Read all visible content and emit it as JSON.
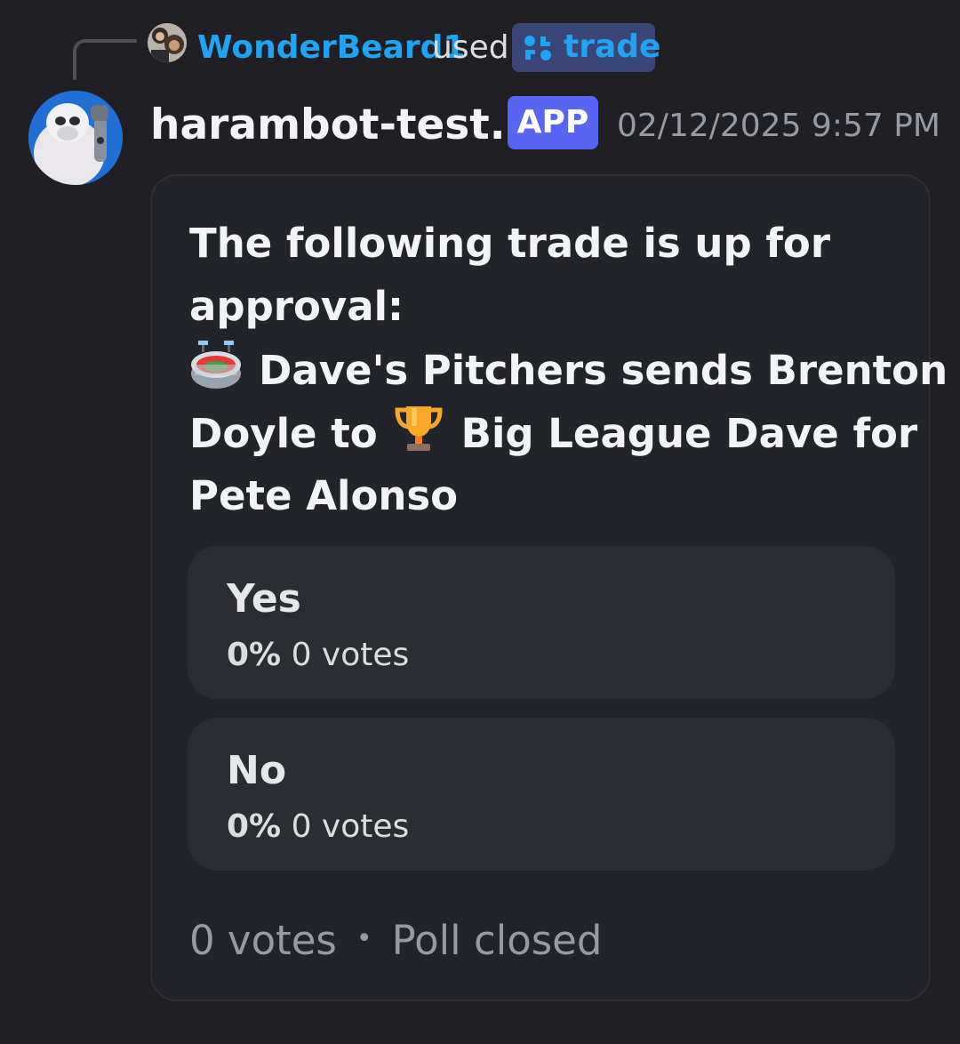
{
  "reply": {
    "user_name": "WonderBeard1",
    "used_text": "used",
    "command_name": "trade",
    "command_icon": "app-command-icon"
  },
  "message": {
    "author": "harambot-test...",
    "badge": "APP",
    "timestamp": "02/12/2025 9:57 PM",
    "avatar_icon": "robot-gorilla-avatar"
  },
  "poll": {
    "question": {
      "line1": "The following trade is up for",
      "line2": "approval:",
      "line3_emoji": "stadium-icon",
      "line3_text": "Dave's Pitchers sends Brenton",
      "line4_text_a": "Doyle to",
      "line4_emoji": "trophy-icon",
      "line4_text_b": "Big League Dave for",
      "line5": "Pete Alonso"
    },
    "options": [
      {
        "label": "Yes",
        "percent": "0%",
        "votes": "0 votes",
        "share": 0
      },
      {
        "label": "No",
        "percent": "0%",
        "votes": "0 votes",
        "share": 0
      }
    ],
    "footer": {
      "total_votes": "0 votes",
      "separator": "•",
      "status": "Poll closed"
    }
  },
  "colors": {
    "background": "#1f1f24",
    "card": "#232429",
    "option": "#2c2d33",
    "link_blue": "#1fa3f2",
    "app_badge": "#5865f2",
    "muted_text": "#949ba4"
  }
}
